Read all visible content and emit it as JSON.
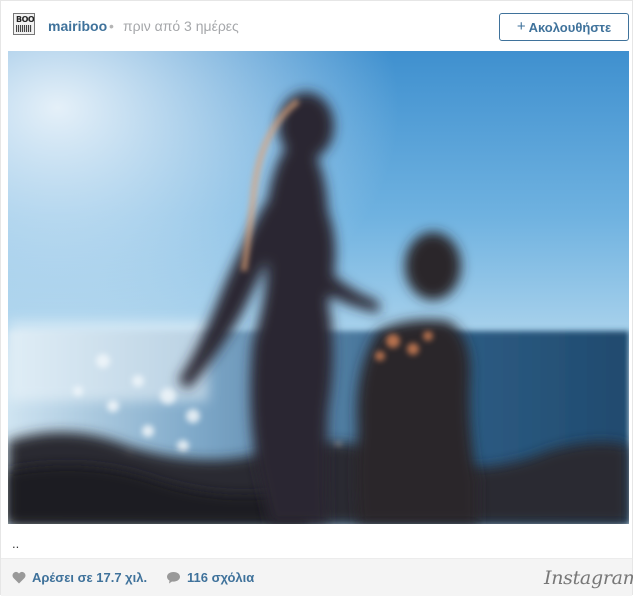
{
  "post": {
    "avatar_text_top": "BOO",
    "username": "mairiboo",
    "separator": "•",
    "time_ago": "πριν από 3 ημέρες",
    "follow_label": "Ακολουθήστε",
    "follow_plus": "+",
    "caption": ".."
  },
  "footer": {
    "likes_label": "Αρέσει σε 17.7 χιλ.",
    "comments_label": "116 σχόλια",
    "brand": "Instagram"
  },
  "icons": {
    "heart": "heart-icon",
    "comment": "comment-bubble-icon"
  },
  "colors": {
    "link_blue": "#3f729b",
    "muted_gray": "#a5a7aa",
    "footer_bg": "#f4f4f4"
  }
}
